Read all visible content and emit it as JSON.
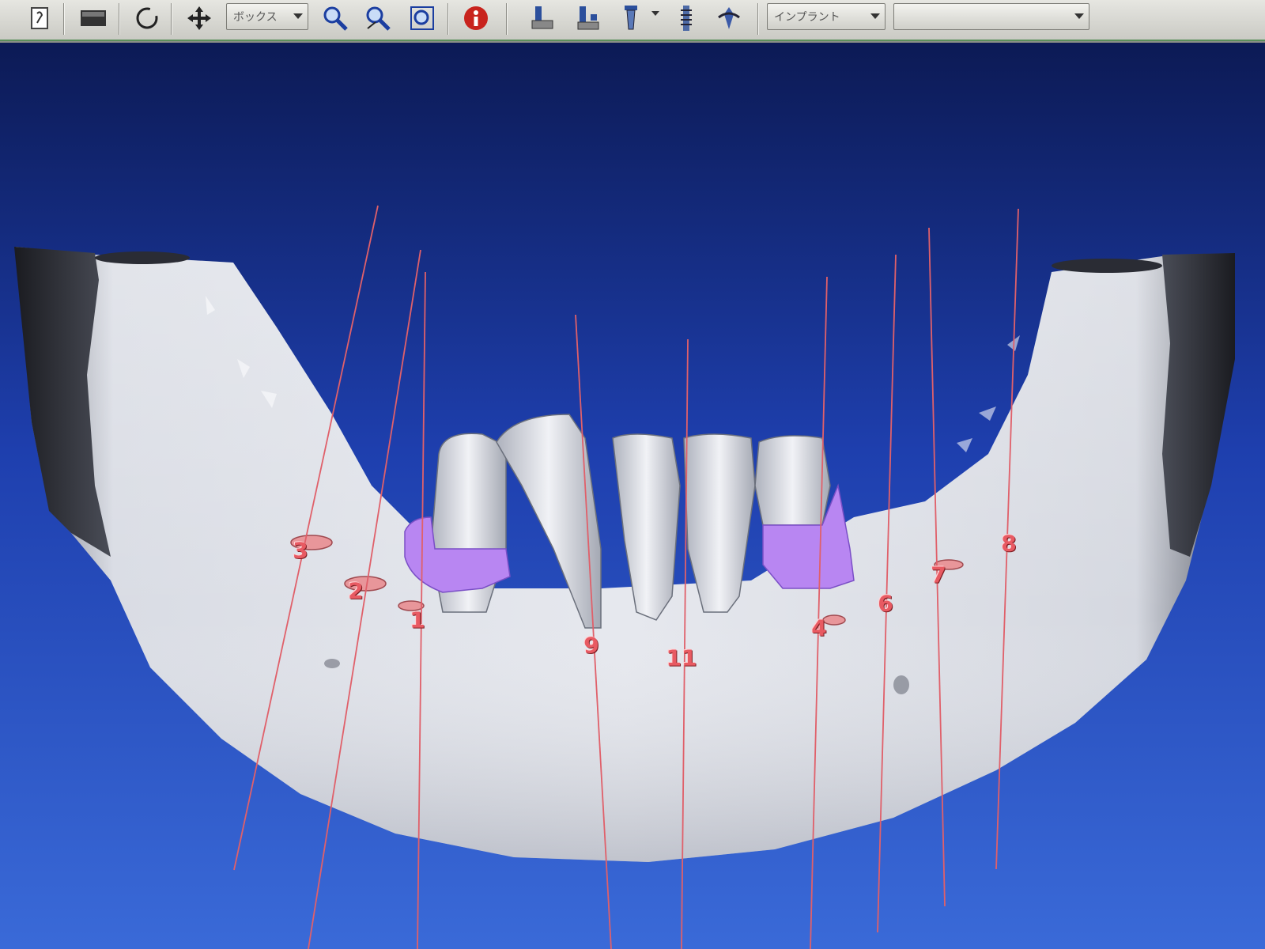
{
  "toolbar": {
    "view_mode_select": "ボックス",
    "object_type_select": "インプラント",
    "secondary_select": ""
  },
  "viewer": {
    "background_colors": [
      "#0c1a55",
      "#1e3fae",
      "#3a6ad8"
    ],
    "bone_color": "#c8ccd6",
    "implant_line_color": "#e0606a",
    "sleeve_color": "#b886f2",
    "ring_color": "#e8969a"
  },
  "implant_markers": [
    {
      "id": "1",
      "label": "1"
    },
    {
      "id": "2",
      "label": "2"
    },
    {
      "id": "3",
      "label": "3"
    },
    {
      "id": "4",
      "label": "4"
    },
    {
      "id": "6",
      "label": "6"
    },
    {
      "id": "7",
      "label": "7"
    },
    {
      "id": "8",
      "label": "8"
    },
    {
      "id": "9",
      "label": "9"
    },
    {
      "id": "11",
      "label": "11"
    }
  ]
}
